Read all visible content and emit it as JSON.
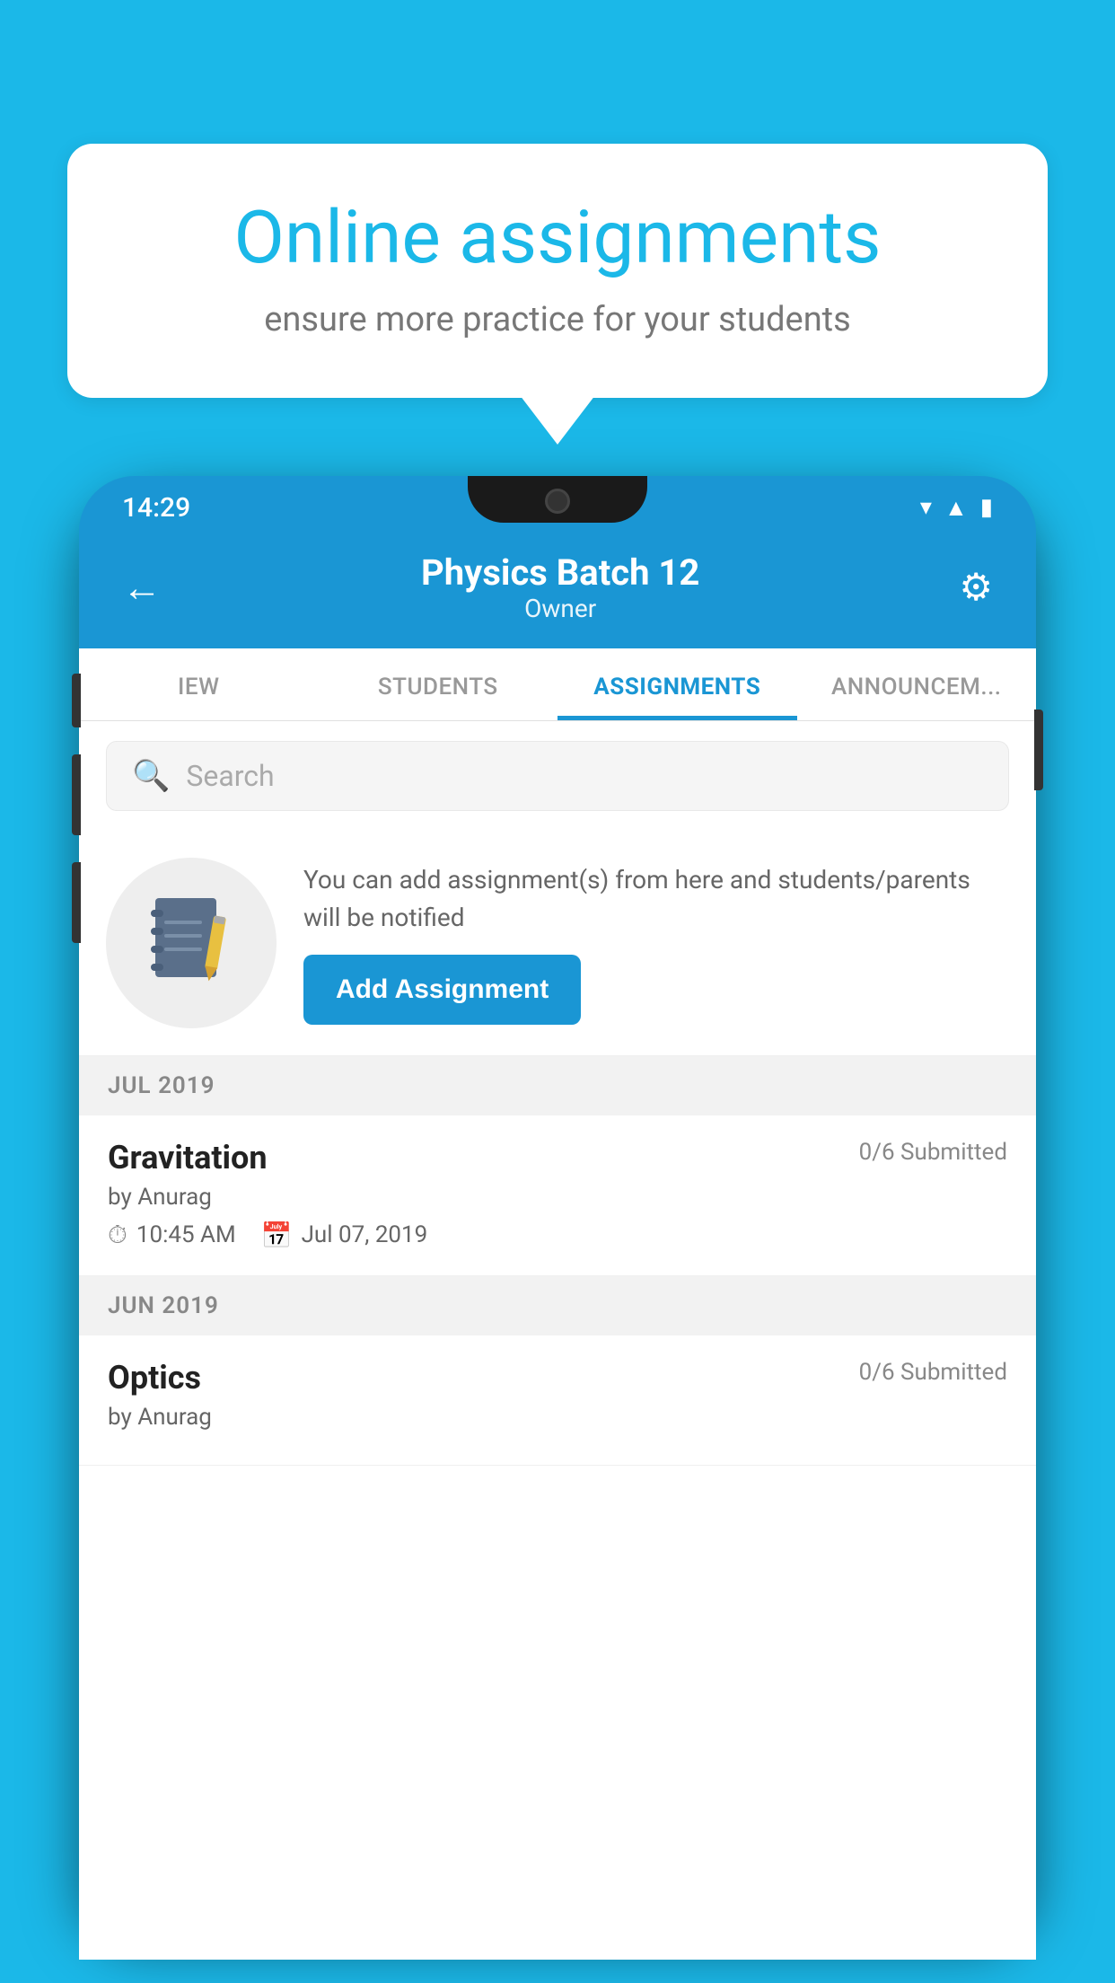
{
  "background": {
    "color": "#1bb8e8"
  },
  "speech_bubble": {
    "title": "Online assignments",
    "subtitle": "ensure more practice for your students"
  },
  "phone": {
    "status_bar": {
      "time": "14:29",
      "icons": [
        "wifi",
        "signal",
        "battery"
      ]
    },
    "header": {
      "title": "Physics Batch 12",
      "subtitle": "Owner",
      "back_label": "←",
      "settings_label": "⚙"
    },
    "tabs": [
      {
        "label": "IEW",
        "active": false
      },
      {
        "label": "STUDENTS",
        "active": false
      },
      {
        "label": "ASSIGNMENTS",
        "active": true
      },
      {
        "label": "ANNOUNCEM...",
        "active": false
      }
    ],
    "search": {
      "placeholder": "Search"
    },
    "info_section": {
      "description": "You can add assignment(s) from here and students/parents will be notified",
      "button_label": "Add Assignment"
    },
    "sections": [
      {
        "label": "JUL 2019",
        "assignments": [
          {
            "title": "Gravitation",
            "submitted": "0/6 Submitted",
            "by": "by Anurag",
            "time": "10:45 AM",
            "date": "Jul 07, 2019"
          }
        ]
      },
      {
        "label": "JUN 2019",
        "assignments": [
          {
            "title": "Optics",
            "submitted": "0/6 Submitted",
            "by": "by Anurag",
            "time": "",
            "date": ""
          }
        ]
      }
    ]
  }
}
